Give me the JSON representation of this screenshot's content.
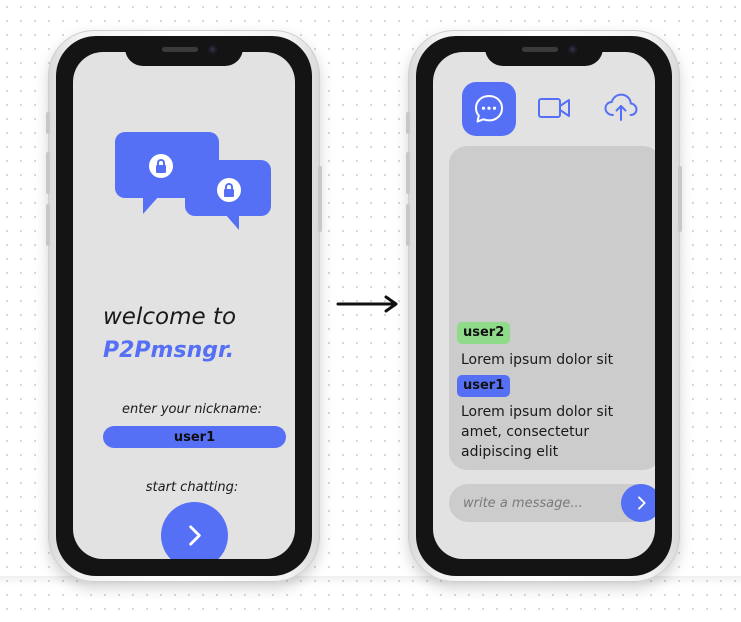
{
  "theme": {
    "accent": "#5570f5",
    "user2_color": "#8fdb8a",
    "screen_bg": "#e2e2e2",
    "panel_bg": "#cccccc"
  },
  "login_screen": {
    "logo_icon": "chat-lock-icon",
    "welcome_text": "welcome to",
    "app_name": "P2Pmsngr.",
    "nickname_label": "enter your nickname:",
    "nickname_value": "user1",
    "start_label": "start chatting:",
    "start_icon": "chevron-right-icon"
  },
  "transition_icon": "arrow-right-icon",
  "chat_screen": {
    "tabs": [
      {
        "icon": "chat-bubble-icon",
        "active": true
      },
      {
        "icon": "video-camera-icon",
        "active": false
      },
      {
        "icon": "cloud-upload-icon",
        "active": false
      }
    ],
    "messages": [
      {
        "user": "user2",
        "text": "Lorem ipsum dolor sit"
      },
      {
        "user": "user1",
        "text": "Lorem ipsum dolor sit amet, consectetur adipiscing elit"
      }
    ],
    "composer_placeholder": "write a message...",
    "send_icon": "chevron-right-icon"
  }
}
